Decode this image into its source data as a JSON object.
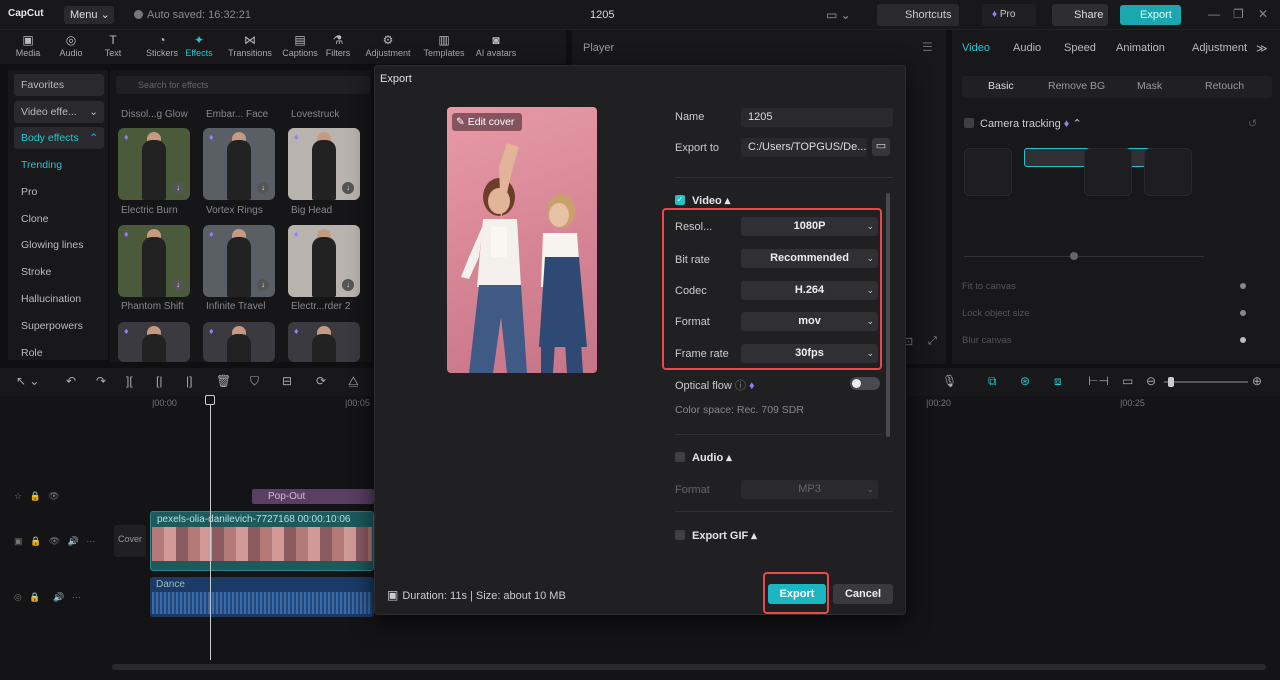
{
  "app": {
    "logo": "CapCut",
    "menu": "Menu",
    "autosave": "Auto saved: 16:32:21",
    "project_title": "1205",
    "shortcuts": "Shortcuts",
    "pro": "Pro",
    "share": "Share",
    "export": "Export"
  },
  "toolbar": [
    {
      "label": "Media",
      "icon": "media-icon",
      "glyph": "▣"
    },
    {
      "label": "Audio",
      "icon": "audio-icon",
      "glyph": "◎"
    },
    {
      "label": "Text",
      "icon": "text-icon",
      "glyph": "T"
    },
    {
      "label": "Stickers",
      "icon": "stickers-icon",
      "glyph": "◔"
    },
    {
      "label": "Effects",
      "icon": "effects-icon",
      "glyph": "✦"
    },
    {
      "label": "Transitions",
      "icon": "transitions-icon",
      "glyph": "⋈"
    },
    {
      "label": "Captions",
      "icon": "captions-icon",
      "glyph": "▤"
    },
    {
      "label": "Filters",
      "icon": "filters-icon",
      "glyph": "⚗"
    },
    {
      "label": "Adjustment",
      "icon": "adjustment-icon",
      "glyph": "⚙"
    },
    {
      "label": "Templates",
      "icon": "templates-icon",
      "glyph": "▥"
    },
    {
      "label": "AI avatars",
      "icon": "ai-avatars-icon",
      "glyph": "◙"
    }
  ],
  "sidebar": {
    "favorites": "Favorites",
    "video_effects": "Video effe...",
    "body_effects": "Body effects",
    "items": [
      "Trending",
      "Pro",
      "Clone",
      "Glowing lines",
      "Stroke",
      "Hallucination",
      "Superpowers",
      "Role"
    ]
  },
  "effects": {
    "search_placeholder": "Search for effects",
    "top_row": [
      "Dissol...g Glow",
      "Embar... Face",
      "Lovestruck"
    ],
    "row1": [
      "Electric Burn",
      "Vortex Rings",
      "Big Head"
    ],
    "row2": [
      "Phantom Shift",
      "Infinite Travel",
      "Electr...rder 2"
    ]
  },
  "player": {
    "title": "Player"
  },
  "right_panel": {
    "tabs": [
      "Video",
      "Audio",
      "Speed",
      "Animation",
      "Adjustment"
    ],
    "subtabs": [
      "Basic",
      "Remove BG",
      "Mask",
      "Retouch"
    ],
    "camera_tracking": "Camera tracking",
    "fit_to_canvas": "Fit to canvas",
    "lock_object_size": "Lock object size",
    "blur_canvas": "Blur canvas"
  },
  "timeline": {
    "ruler": [
      "|00:00",
      "|00:05",
      "|00:20",
      "|00:25"
    ],
    "popout_label": "Pop-Out",
    "video_clip_label": "pexels-olia-danilevich-7727168  00:00:10:06",
    "cover_label": "Cover",
    "audio_clip_label": "Dance"
  },
  "dialog": {
    "title": "Export",
    "edit_cover": "Edit cover",
    "name_label": "Name",
    "name_value": "1205",
    "export_to_label": "Export to",
    "export_to_value": "C:/Users/TOPGUS/De...",
    "video_section": "Video ▴",
    "resolution_label": "Resol...",
    "resolution_value": "1080P",
    "bitrate_label": "Bit rate",
    "bitrate_value": "Recommended",
    "codec_label": "Codec",
    "codec_value": "H.264",
    "format_label": "Format",
    "format_value": "mov",
    "framerate_label": "Frame rate",
    "framerate_value": "30fps",
    "optical_flow": "Optical flow",
    "color_space": "Color space: Rec. 709 SDR",
    "audio_section": "Audio ▴",
    "audio_format_label": "Format",
    "audio_format_value": "MP3",
    "gif_section": "Export GIF ▴",
    "footer_info": "Duration: 11s | Size: about 10 MB",
    "export_button": "Export",
    "cancel_button": "Cancel"
  },
  "colors": {
    "accent": "#1bb6c2",
    "highlight": "#e84a4a",
    "premium": "#9a7bff"
  }
}
